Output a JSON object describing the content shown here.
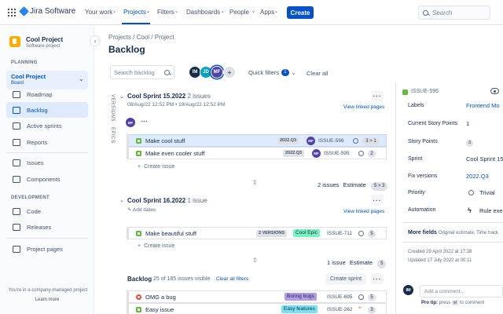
{
  "topnav": {
    "product": "Jira Software",
    "items": [
      "Your work",
      "Projects",
      "Filters",
      "Dashboards",
      "People",
      "Apps"
    ],
    "create_label": "Create",
    "search_placeholder": "Search",
    "active_color": "#0052cc"
  },
  "sidebar": {
    "project_name": "Cool Project",
    "project_type": "Software project",
    "planning_heading": "PLANNING",
    "board_name": "Cool Project",
    "board_sub": "Board",
    "items": [
      "Roadmap",
      "Backlog",
      "Active sprints",
      "Reports",
      "Issues",
      "Components"
    ],
    "development_heading": "DEVELOPMENT",
    "dev_items": [
      "Code",
      "Releases"
    ],
    "project_pages": "Project pages",
    "footer_text": "You're in a company-managed project",
    "learn_more": "Learn more"
  },
  "breadcrumb": "Projects  /  Cool  /  Project",
  "page_title": "Backlog",
  "toolbar": {
    "search_placeholder": "Search backlog",
    "avatars": [
      {
        "initials": "IM",
        "color": "#172b4d"
      },
      {
        "initials": "JD",
        "color": "#00a3bf"
      },
      {
        "initials": "MF",
        "color": "#5243aa"
      }
    ],
    "quick_filters": "Quick filters",
    "quick_filters_count": "1",
    "clear_all": "Clear all"
  },
  "side_tabs": [
    "VERSIONS",
    "EPICS"
  ],
  "sprints": [
    {
      "name": "Cool Sprint 15.2022",
      "count": "2 issues",
      "dates": "08/Aug/22 12:52 PM  •  19/Aug/22 12:52 PM",
      "assignee": "MF",
      "view_linked": "View linked pages",
      "issues": [
        {
          "summary": "Make cool stuff",
          "lozenge": "2022.Q3",
          "assignee": "MF",
          "key": "ISSUE-596",
          "estimate": "3 > 1"
        },
        {
          "summary": "Make even cooler stuff",
          "lozenge": "2022.Q3",
          "assignee": "MF",
          "key": "ISSUE-595",
          "estimate": "2"
        }
      ],
      "create_issue": "Create issue",
      "footer_count": "2 issues",
      "footer_estimate_label": "Estimate",
      "footer_estimate": "5 > 3"
    },
    {
      "name": "Cool Sprint 16.2022",
      "count": "1 issue",
      "add_dates": "Add dates",
      "view_linked": "View linked pages",
      "issues": [
        {
          "summary": "Make beautiful stuff",
          "lozenge": "2 VERSIONS",
          "epic": "Cool Epic",
          "key": "ISSUE-711",
          "estimate": "5"
        }
      ],
      "create_issue": "Create issue",
      "footer_count": "1 issue",
      "footer_estimate_label": "Estimate",
      "footer_estimate": "5"
    }
  ],
  "backlog": {
    "title": "Backlog",
    "count": "25 of 185 issues visible",
    "clear_filters": "Clear all filters",
    "create_sprint": "Create sprint",
    "issues": [
      {
        "summary": "OMG a bug",
        "epic": "Boring bugs",
        "key": "ISSUE-695",
        "estimate": "5"
      },
      {
        "summary": "Easy issue",
        "epic": "Easy features",
        "key": "ISSUE-262",
        "estimate": "3"
      }
    ]
  },
  "details": {
    "key": "ISSUE-596",
    "fields": [
      {
        "label": "Labels",
        "value": "Frontend   Mo"
      },
      {
        "label": "Current Story Points",
        "value": "1"
      },
      {
        "label": "Story Points",
        "value": "3"
      },
      {
        "label": "Sprint",
        "value": "Cool Sprint 15"
      },
      {
        "label": "Fix versions",
        "value": "2022.Q3"
      },
      {
        "label": "Priority",
        "value": "Trivial"
      },
      {
        "label": "Automation",
        "value": "Rule exec"
      }
    ],
    "more_fields": "More fields",
    "more_fields_sub": "Original estimate, Time track",
    "created": "Created 29 April 2022 at 17:28",
    "updated": "Updated 17 July 2022 at 00:11",
    "comment_avatar": "IM",
    "comment_placeholder": "Add a comment...",
    "protip_label": "Pro tip:",
    "protip_text_1": "press",
    "protip_key": "M",
    "protip_text_2": "to comment"
  }
}
